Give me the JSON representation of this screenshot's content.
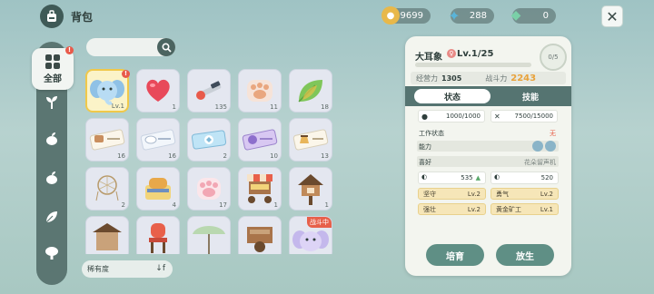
{
  "header": {
    "title": "背包",
    "currencies": [
      {
        "name": "coin",
        "value": "9699",
        "color": "#e8b84a"
      },
      {
        "name": "crystal",
        "value": "288",
        "color": "#5ab4d8"
      },
      {
        "name": "gem",
        "value": "0",
        "color": "#7ad0a8"
      }
    ]
  },
  "sidebar": {
    "all_label": "全部",
    "badge": "!",
    "items": [
      {
        "icon": "sprout-icon"
      },
      {
        "icon": "leaf-bud-icon"
      },
      {
        "icon": "leaf-bud-icon"
      },
      {
        "icon": "leaf-hand-icon"
      },
      {
        "icon": "tree-icon"
      }
    ]
  },
  "search": {
    "placeholder": ""
  },
  "grid": {
    "items": [
      {
        "name": "elephant",
        "count": "Lv.1",
        "selected": true,
        "badge": "!"
      },
      {
        "name": "heart",
        "count": "1"
      },
      {
        "name": "brush-tools",
        "count": "135"
      },
      {
        "name": "paw-cushion",
        "count": "11"
      },
      {
        "name": "green-leaf",
        "count": "18"
      },
      {
        "name": "ticket-cake",
        "count": "16"
      },
      {
        "name": "ticket-cloud",
        "count": "16"
      },
      {
        "name": "ticket-blue",
        "count": "2"
      },
      {
        "name": "ticket-purple",
        "count": "10"
      },
      {
        "name": "ticket-pudding",
        "count": "13"
      },
      {
        "name": "dreamcatcher",
        "count": "2"
      },
      {
        "name": "toast-box",
        "count": "4"
      },
      {
        "name": "paw-pink",
        "count": "17"
      },
      {
        "name": "market-stall",
        "count": "1"
      },
      {
        "name": "treehouse",
        "count": "1"
      },
      {
        "name": "house-roof",
        "count": ""
      },
      {
        "name": "red-chair",
        "count": ""
      },
      {
        "name": "parasol",
        "count": ""
      },
      {
        "name": "wood-cart",
        "count": ""
      },
      {
        "name": "elephant-2",
        "count": "",
        "tag": "战斗中"
      }
    ]
  },
  "rarity_label": "稀有度",
  "sort_glyph": "↓f",
  "panel": {
    "name": "大耳象",
    "level": "Lv.1/25",
    "gender_glyph": "♀",
    "count": "0/5",
    "exp_label": "经营力",
    "exp_value": "1305",
    "power_label": "战斗力",
    "power_value": "2243",
    "tab_status": "状态",
    "tab_skill": "技能",
    "food": "1000/1000",
    "tools": "7500/15000",
    "work_label": "工作状态",
    "work_value": "无",
    "ability_label": "能力",
    "like_label": "喜好",
    "like_value": "花朵留声机",
    "like_a": "535",
    "like_b": "520",
    "traits": [
      {
        "name": "坚守",
        "lv": "Lv.2"
      },
      {
        "name": "勇气",
        "lv": "Lv.2"
      },
      {
        "name": "强壮",
        "lv": "Lv.2"
      },
      {
        "name": "黄金矿工",
        "lv": "Lv.1"
      }
    ],
    "btn_train": "培育",
    "btn_release": "放生"
  }
}
